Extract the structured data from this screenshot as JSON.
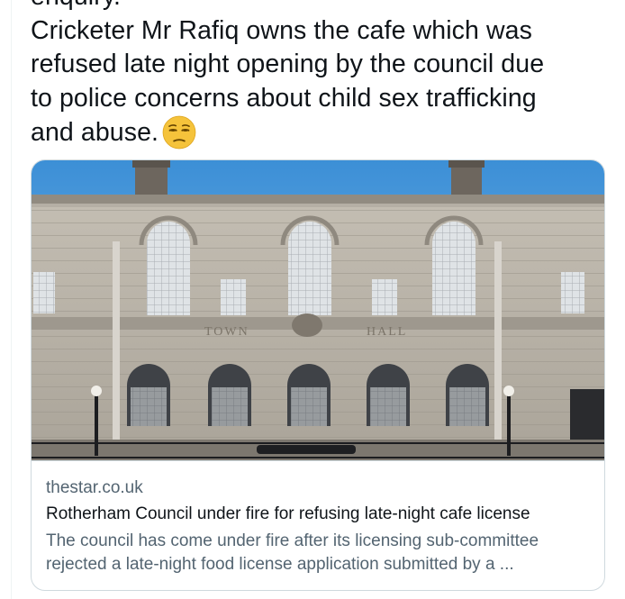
{
  "tweet": {
    "text_line_0": "enquiry.",
    "text_line_1": "Cricketer Mr Rafiq owns the cafe which was",
    "text_line_2": "refused late night opening by the council due",
    "text_line_3": "to police concerns about child sex trafficking",
    "text_line_4": "and abuse.",
    "emoji": "unamused-face-icon"
  },
  "card": {
    "image_icon": "town-hall-photo",
    "image_lettering": [
      "TOWN",
      "HALL"
    ],
    "domain": "thestar.co.uk",
    "title": "Rotherham Council under fire for refusing late-night cafe license",
    "description": "The council has come under fire after its licensing sub-committee rejected a late-night food license application submitted by a ..."
  },
  "colors": {
    "text_primary": "#0f1419",
    "text_secondary": "#536471",
    "border": "#cfd9de",
    "emoji_fill": "#f5c33b"
  }
}
